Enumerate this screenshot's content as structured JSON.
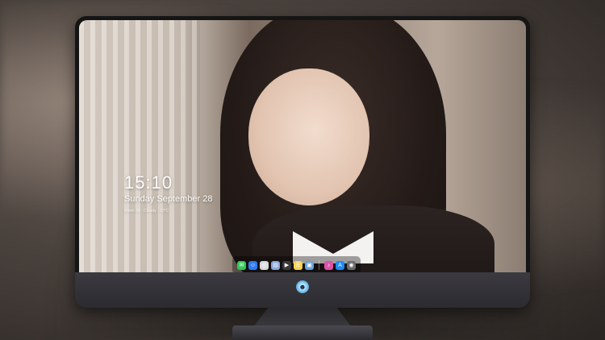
{
  "lockscreen": {
    "time": "15:10",
    "date": "Sunday September 28",
    "subtext": "Week 39 · Cloudy · 23°C"
  },
  "dock": {
    "apps": [
      {
        "name": "messages",
        "glyph": "✉",
        "color": "#34c759"
      },
      {
        "name": "finder",
        "glyph": "☺",
        "color": "#2f7bf6"
      },
      {
        "name": "safari",
        "glyph": "◎",
        "color": "#d9d9d9"
      },
      {
        "name": "preview",
        "glyph": "▤",
        "color": "#8ca6d9"
      },
      {
        "name": "clapper",
        "glyph": "▶",
        "color": "#3a3a3a"
      },
      {
        "name": "notes",
        "glyph": "☰",
        "color": "#f7d44c"
      },
      {
        "name": "photos",
        "glyph": "▣",
        "color": "#6aa1d6"
      },
      {
        "name": "music",
        "glyph": "♪",
        "color": "#e051a8"
      },
      {
        "name": "app-store",
        "glyph": "A",
        "color": "#1c8cf3"
      },
      {
        "name": "camera",
        "glyph": "◉",
        "color": "#6b6b6b"
      }
    ]
  },
  "brand": {
    "logo_icon": "alien-logo-icon"
  }
}
